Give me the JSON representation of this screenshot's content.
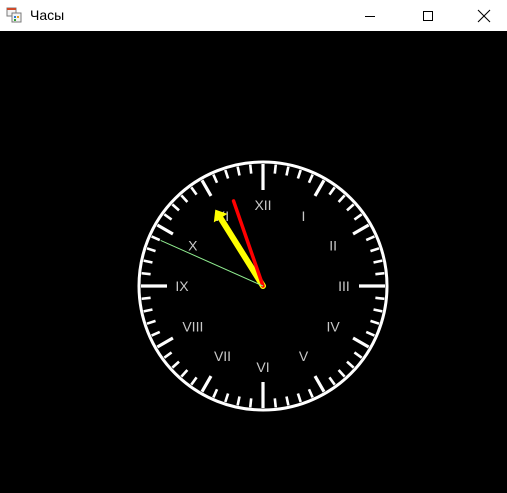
{
  "window": {
    "title": "Часы",
    "app_icon": "windows-forms-app-icon",
    "controls": [
      "minimize-icon",
      "maximize-icon",
      "close-icon"
    ]
  },
  "clock": {
    "numerals": [
      "XII",
      "I",
      "II",
      "III",
      "IV",
      "V",
      "VI",
      "VII",
      "VIII",
      "IX",
      "X",
      "XI"
    ],
    "time": {
      "hour": 10,
      "minute": 56,
      "second": 49
    },
    "colors": {
      "face": "#000000",
      "rim": "#ffffff",
      "ticks": "#ffffff",
      "numerals": "#c8c8c8",
      "hour_hand": "#ffff00",
      "minute_hand": "#ff0000",
      "second_hand": "#90ee90"
    }
  }
}
